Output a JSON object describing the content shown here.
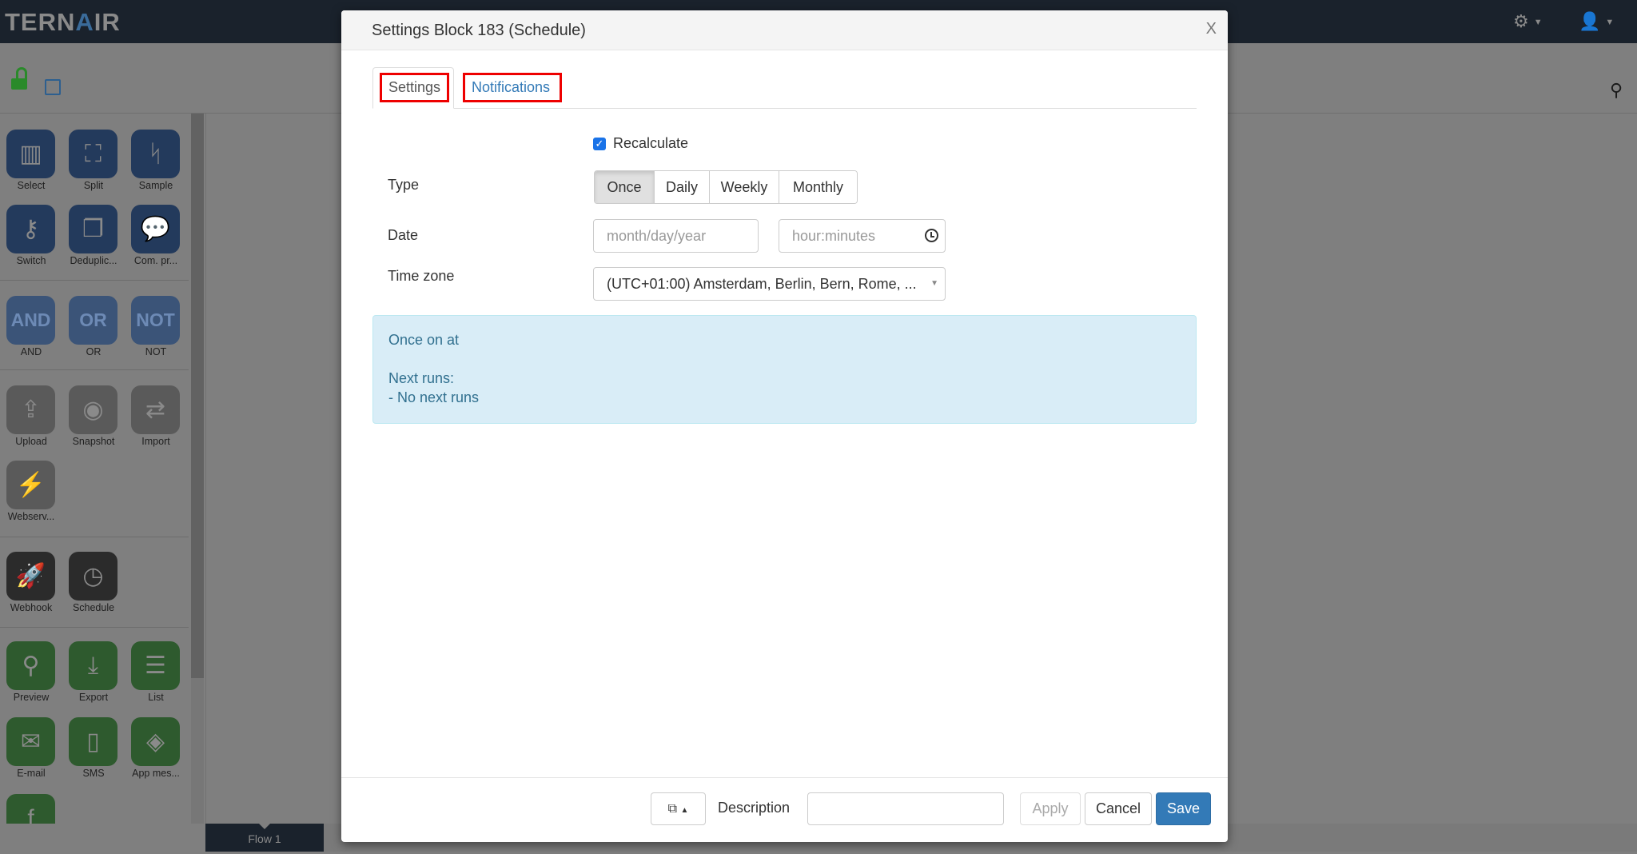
{
  "app": {
    "logo_text": "TERNAIR",
    "logo_text_pre": "TERN",
    "logo_text_a": "A",
    "logo_text_post": "IR"
  },
  "header": {
    "settings_icon": "gear-icon",
    "user_icon": "user-icon",
    "search_icon": "search-icon"
  },
  "toolbar": {
    "lock_icon": "unlock-icon",
    "save_icon": "floppy-icon"
  },
  "sidebar": {
    "groups": [
      {
        "color": "#233a5c",
        "items": [
          {
            "label": "Select",
            "icon": "▥"
          },
          {
            "label": "Split",
            "icon": "⛶"
          },
          {
            "label": "Sample",
            "icon": "ᛋ"
          },
          {
            "label": "Switch",
            "icon": "⚷"
          },
          {
            "label": "Deduplic...",
            "icon": "❐"
          },
          {
            "label": "Com. pr...",
            "icon": "💬"
          }
        ]
      },
      {
        "color": "#3b5478",
        "text": true,
        "items": [
          {
            "label": "AND",
            "icon": "AND"
          },
          {
            "label": "OR",
            "icon": "OR"
          },
          {
            "label": "NOT",
            "icon": "NOT"
          }
        ]
      },
      {
        "color": "#5a5a5a",
        "items": [
          {
            "label": "Upload",
            "icon": "⇪"
          },
          {
            "label": "Snapshot",
            "icon": "◉"
          },
          {
            "label": "Import",
            "icon": "⇄"
          },
          {
            "label": "Webserv...",
            "icon": "⚡"
          }
        ]
      },
      {
        "color": "#2b2b2b",
        "items": [
          {
            "label": "Webhook",
            "icon": "🚀"
          },
          {
            "label": "Schedule",
            "icon": "◷"
          }
        ]
      },
      {
        "color": "#2e5a2e",
        "items": [
          {
            "label": "Preview",
            "icon": "⚲"
          },
          {
            "label": "Export",
            "icon": "⤓"
          },
          {
            "label": "List",
            "icon": "☰"
          },
          {
            "label": "E-mail",
            "icon": "✉"
          },
          {
            "label": "SMS",
            "icon": "▯"
          },
          {
            "label": "App mes...",
            "icon": "◈"
          },
          {
            "label": "",
            "icon": "f"
          }
        ]
      }
    ]
  },
  "flow_tab": "Flow 1",
  "modal": {
    "title": "Settings Block 183 (Schedule)",
    "close": "X",
    "tabs": [
      {
        "label": "Settings",
        "active": true
      },
      {
        "label": "Notifications",
        "active": false
      }
    ],
    "recalculate": {
      "label": "Recalculate",
      "checked": true
    },
    "type": {
      "label": "Type",
      "options": [
        "Once",
        "Daily",
        "Weekly",
        "Monthly"
      ],
      "selected": "Once"
    },
    "date": {
      "label": "Date",
      "date_placeholder": "month/day/year",
      "time_placeholder": "hour:minutes"
    },
    "timezone": {
      "label": "Time zone",
      "value": "(UTC+01:00) Amsterdam, Berlin, Bern, Rome, ..."
    },
    "info": {
      "line1": "Once on at",
      "line2": "Next runs:",
      "line3": "- No next runs"
    },
    "footer": {
      "copy_icon": "copy-icon",
      "description_label": "Description",
      "description_value": "",
      "apply": "Apply",
      "cancel": "Cancel",
      "save": "Save"
    }
  }
}
